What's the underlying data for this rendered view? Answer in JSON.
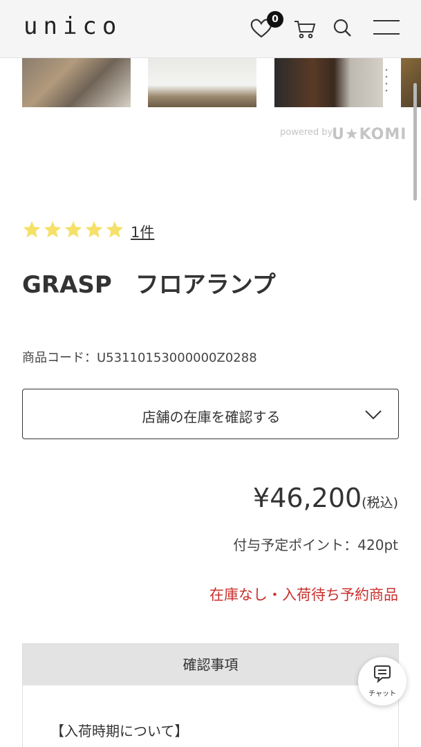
{
  "header": {
    "logo": "unico",
    "favorites_count": "0",
    "icons": [
      "heart-icon",
      "cart-icon",
      "search-icon",
      "menu-icon"
    ]
  },
  "reviews_widget": {
    "powered_by": "powered by",
    "brand": "U★KOMI"
  },
  "product": {
    "rating_stars": 5,
    "review_count": "1件",
    "name": "GRASP　フロアランプ",
    "code": "商品コード：U53110153000000Z0288",
    "stock_check_label": "店舗の在庫を確認する",
    "price": "¥46,200",
    "tax_note": "(税込)",
    "points": "付与予定ポイント：420pt",
    "status": "在庫なし・入荷待ち予約商品"
  },
  "confirm": {
    "heading": "確認事項",
    "arrival_title": "【入荷時期について】"
  },
  "chat": {
    "label": "チャット"
  },
  "colors": {
    "accent_red": "#c9302c",
    "star_yellow": "#f5e16a",
    "header_bg": "#f5f5f5"
  }
}
